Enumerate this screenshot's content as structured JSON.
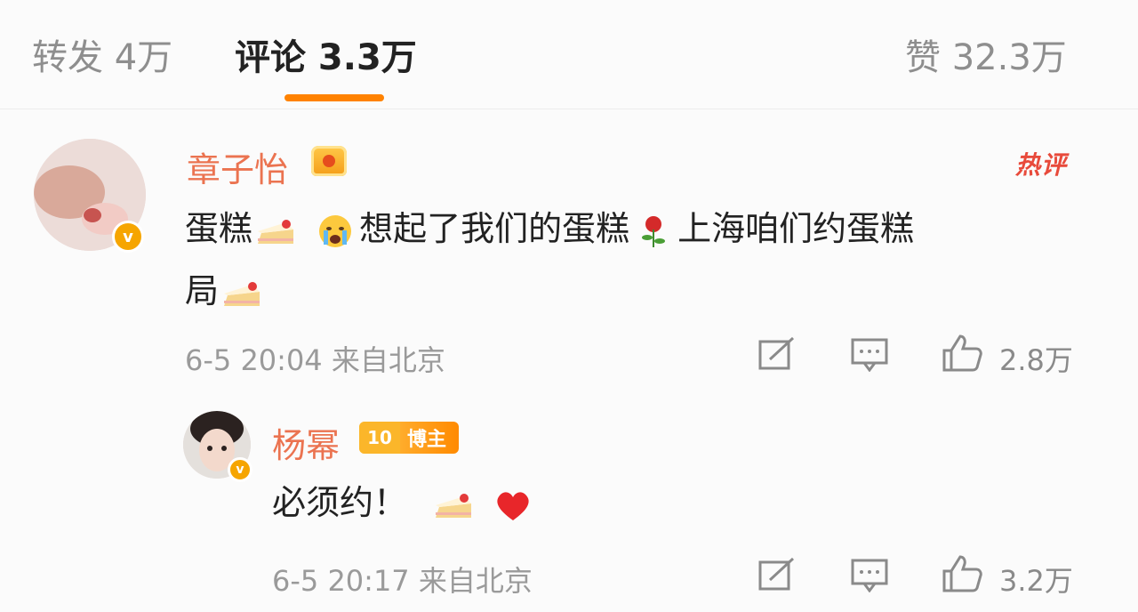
{
  "tabs": {
    "repost": "转发 4万",
    "comment": "评论 3.3万",
    "like": "赞 32.3万"
  },
  "comments": [
    {
      "user": "章子怡",
      "hot_tag": "热评",
      "text_parts": [
        "蛋糕",
        "想起了我们的蛋糕",
        "上海咱们约蛋糕",
        "局"
      ],
      "time_location": "6-5 20:04 来自北京",
      "likes": "2.8万",
      "verified_badge": "v"
    }
  ],
  "reply": {
    "user": "杨幂",
    "level": "10",
    "role_badge": "博主",
    "text": "必须约！",
    "time_location": "6-5 20:17 来自北京",
    "likes": "3.2万",
    "verified_badge": "v"
  },
  "colors": {
    "accent": "#ff8200",
    "username": "#eb7350",
    "hot": "#e84a3b",
    "verified": "#f6a500"
  },
  "icons": [
    "share-icon",
    "comment-icon",
    "like-icon",
    "cake-emoji",
    "crying-emoji",
    "rose-emoji",
    "heart-emoji",
    "crown-icon"
  ]
}
